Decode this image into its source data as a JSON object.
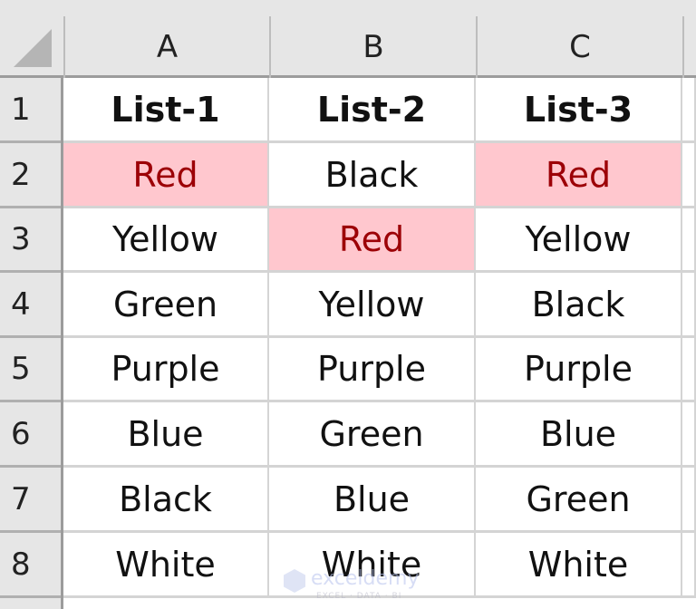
{
  "columns": [
    "A",
    "B",
    "C"
  ],
  "rows": [
    "1",
    "2",
    "3",
    "4",
    "5",
    "6",
    "7",
    "8"
  ],
  "header_row": [
    "List-1",
    "List-2",
    "List-3"
  ],
  "data": [
    [
      "Red",
      "Black",
      "Red"
    ],
    [
      "Yellow",
      "Red",
      "Yellow"
    ],
    [
      "Green",
      "Yellow",
      "Black"
    ],
    [
      "Purple",
      "Purple",
      "Purple"
    ],
    [
      "Blue",
      "Green",
      "Blue"
    ],
    [
      "Black",
      "Blue",
      "Green"
    ],
    [
      "White",
      "White",
      "White"
    ]
  ],
  "highlighted_cells": [
    "A2",
    "C2",
    "B3"
  ],
  "highlight_colors": {
    "fill": "#ffc7ce",
    "text": "#9c0006"
  },
  "watermark": {
    "name": "exceldemy",
    "tagline": "EXCEL · DATA · BI"
  }
}
